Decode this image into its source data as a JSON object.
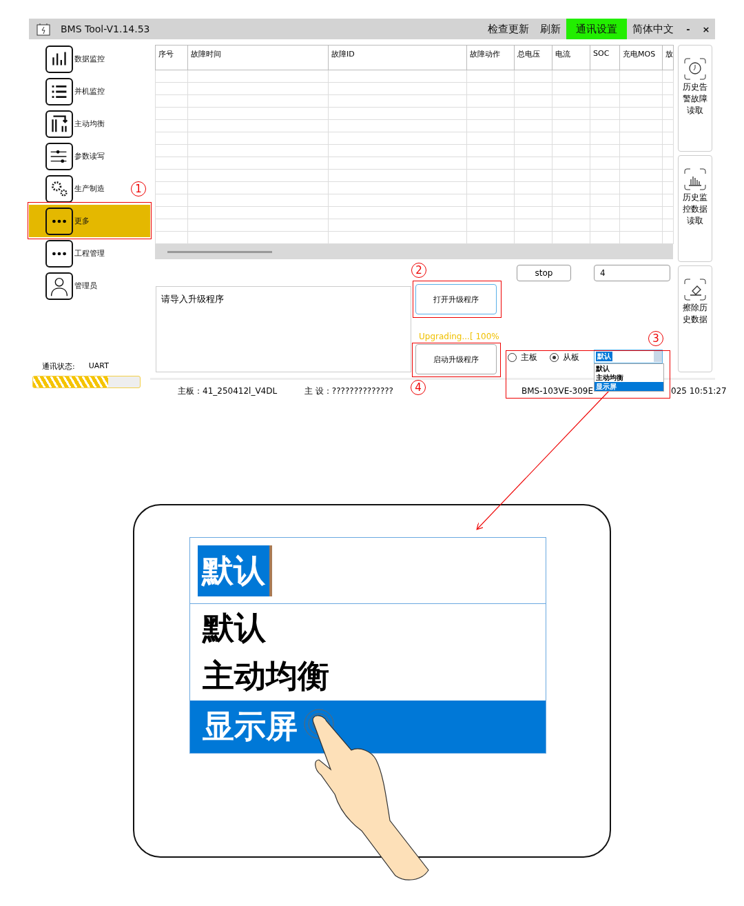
{
  "window": {
    "title": "BMS Tool-V1.14.53",
    "menu": [
      {
        "label": "检查更新",
        "selected": false
      },
      {
        "label": "刷新",
        "selected": false
      },
      {
        "label": "通讯设置",
        "selected": true
      },
      {
        "label": "简体中文",
        "selected": false
      }
    ],
    "controls": [
      "-",
      "×"
    ]
  },
  "sidebar": {
    "items": [
      {
        "label": "数据监控",
        "selected": false
      },
      {
        "label": "并机监控",
        "selected": false
      },
      {
        "label": "主动均衡",
        "selected": false
      },
      {
        "label": "参数读写",
        "selected": false
      },
      {
        "label": "生产制造",
        "selected": false
      },
      {
        "label": "更多",
        "selected": true
      },
      {
        "label": "工程管理",
        "selected": false
      },
      {
        "label": "管理员",
        "selected": false
      }
    ],
    "status": {
      "label": "通讯状态:",
      "value": "UART",
      "level": 0.7
    }
  },
  "table": {
    "columns": [
      "序号",
      "故障时间",
      "故障ID",
      "故障动作",
      "总电压",
      "电流",
      "SOC",
      "充电MOS",
      "放"
    ]
  },
  "controls": {
    "stop_button": "stop",
    "count_field": "4"
  },
  "upgrade": {
    "log": "请导入升级程序",
    "open_button": "打开升级程序",
    "progress_text": "Upgrading...[ 100%",
    "start_button": "启动升级程序",
    "target": [
      {
        "label": "主板",
        "selected": false
      },
      {
        "label": "从板",
        "selected": true
      }
    ],
    "dropdown": {
      "value": "默认",
      "options": [
        {
          "label": "默认",
          "highlighted": false
        },
        {
          "label": "主动均衡",
          "highlighted": false
        },
        {
          "label": "显示屏",
          "highlighted": true
        }
      ]
    }
  },
  "side_buttons": [
    "历史告警故障读取",
    "历史监控数据读取",
    "擦除历史数据"
  ],
  "status_bar": [
    "主板：41_250412l_V4DL",
    "主 设：??????????????",
    "BMS-103VE-309E",
    "025 10:51:27"
  ],
  "callouts": [
    "1",
    "2",
    "3",
    "4"
  ],
  "inset": {
    "value": "默认",
    "options": [
      {
        "label": "默认",
        "highlighted": false
      },
      {
        "label": "主动均衡",
        "highlighted": false
      },
      {
        "label": "显示屏",
        "highlighted": true
      }
    ]
  }
}
